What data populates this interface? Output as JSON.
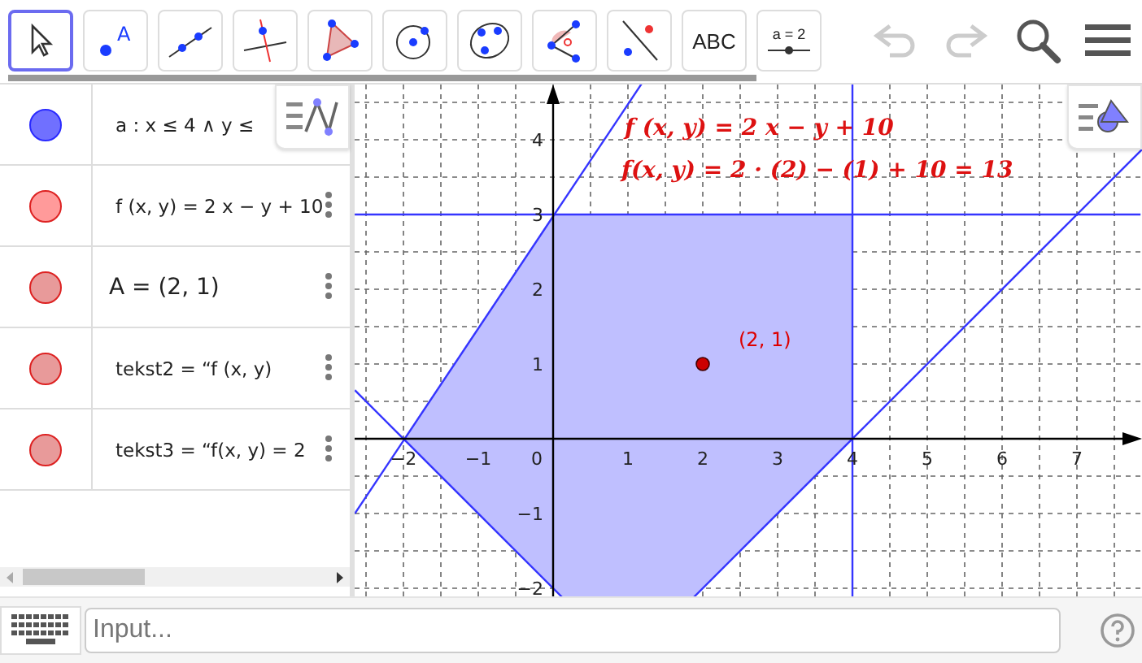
{
  "toolbar": {
    "tools": [
      {
        "kind": "move",
        "selected": true
      },
      {
        "kind": "point",
        "label": "A",
        "selected": false
      },
      {
        "kind": "line",
        "selected": false
      },
      {
        "kind": "perpendicular",
        "selected": false
      },
      {
        "kind": "polygon",
        "selected": false
      },
      {
        "kind": "circle",
        "selected": false
      },
      {
        "kind": "ellipse",
        "selected": false
      },
      {
        "kind": "angle",
        "selected": false
      },
      {
        "kind": "reflect",
        "selected": false
      },
      {
        "kind": "text",
        "label": "ABC",
        "selected": false
      },
      {
        "kind": "slider",
        "label": "a = 2",
        "selected": false
      }
    ]
  },
  "algebra": {
    "items": [
      {
        "text": "a :  x ≤ 4 ∧ y ≤",
        "color": "#7070ff"
      },
      {
        "text": "f (x, y)  =  2 x − y + 10",
        "color": "#ff9a9a",
        "menu": true
      },
      {
        "text": "A = (2, 1)",
        "color": "#e89a9a",
        "menu": true
      },
      {
        "text": "tekst2  =   “f (x, y)",
        "color": "#e89a9a",
        "menu": true
      },
      {
        "text": "tekst3  =   “f(x, y) = 2",
        "color": "#e89a9a",
        "menu": true
      }
    ]
  },
  "graphics": {
    "formula_1": "f (x, y) = 2 x − y + 10",
    "formula_2": "f(x, y) = 2 · (2) − (1) + 10 = 13",
    "point_label": "(2, 1)",
    "x_ticks": [
      "−2",
      "−1",
      "0",
      "1",
      "2",
      "3",
      "4",
      "5",
      "6",
      "7"
    ],
    "y_ticks": [
      "4",
      "3",
      "2",
      "1",
      "−1",
      "−2"
    ]
  },
  "input_bar": {
    "placeholder": "Input..."
  }
}
